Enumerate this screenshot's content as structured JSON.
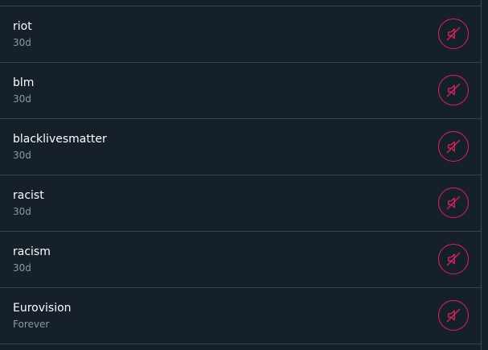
{
  "colors": {
    "background": "#15202b",
    "divider": "#38444d",
    "primary_text": "#ffffff",
    "secondary_text": "#8899a6",
    "accent": "#e0245e"
  },
  "muted_words": [
    {
      "word": "riot",
      "duration": "30d",
      "icon": "speaker-muted-icon"
    },
    {
      "word": "blm",
      "duration": "30d",
      "icon": "speaker-muted-icon"
    },
    {
      "word": "blacklivesmatter",
      "duration": "30d",
      "icon": "speaker-muted-icon"
    },
    {
      "word": "racist",
      "duration": "30d",
      "icon": "speaker-muted-icon"
    },
    {
      "word": "racism",
      "duration": "30d",
      "icon": "speaker-muted-icon"
    },
    {
      "word": "Eurovision",
      "duration": "Forever",
      "icon": "speaker-muted-icon"
    }
  ]
}
